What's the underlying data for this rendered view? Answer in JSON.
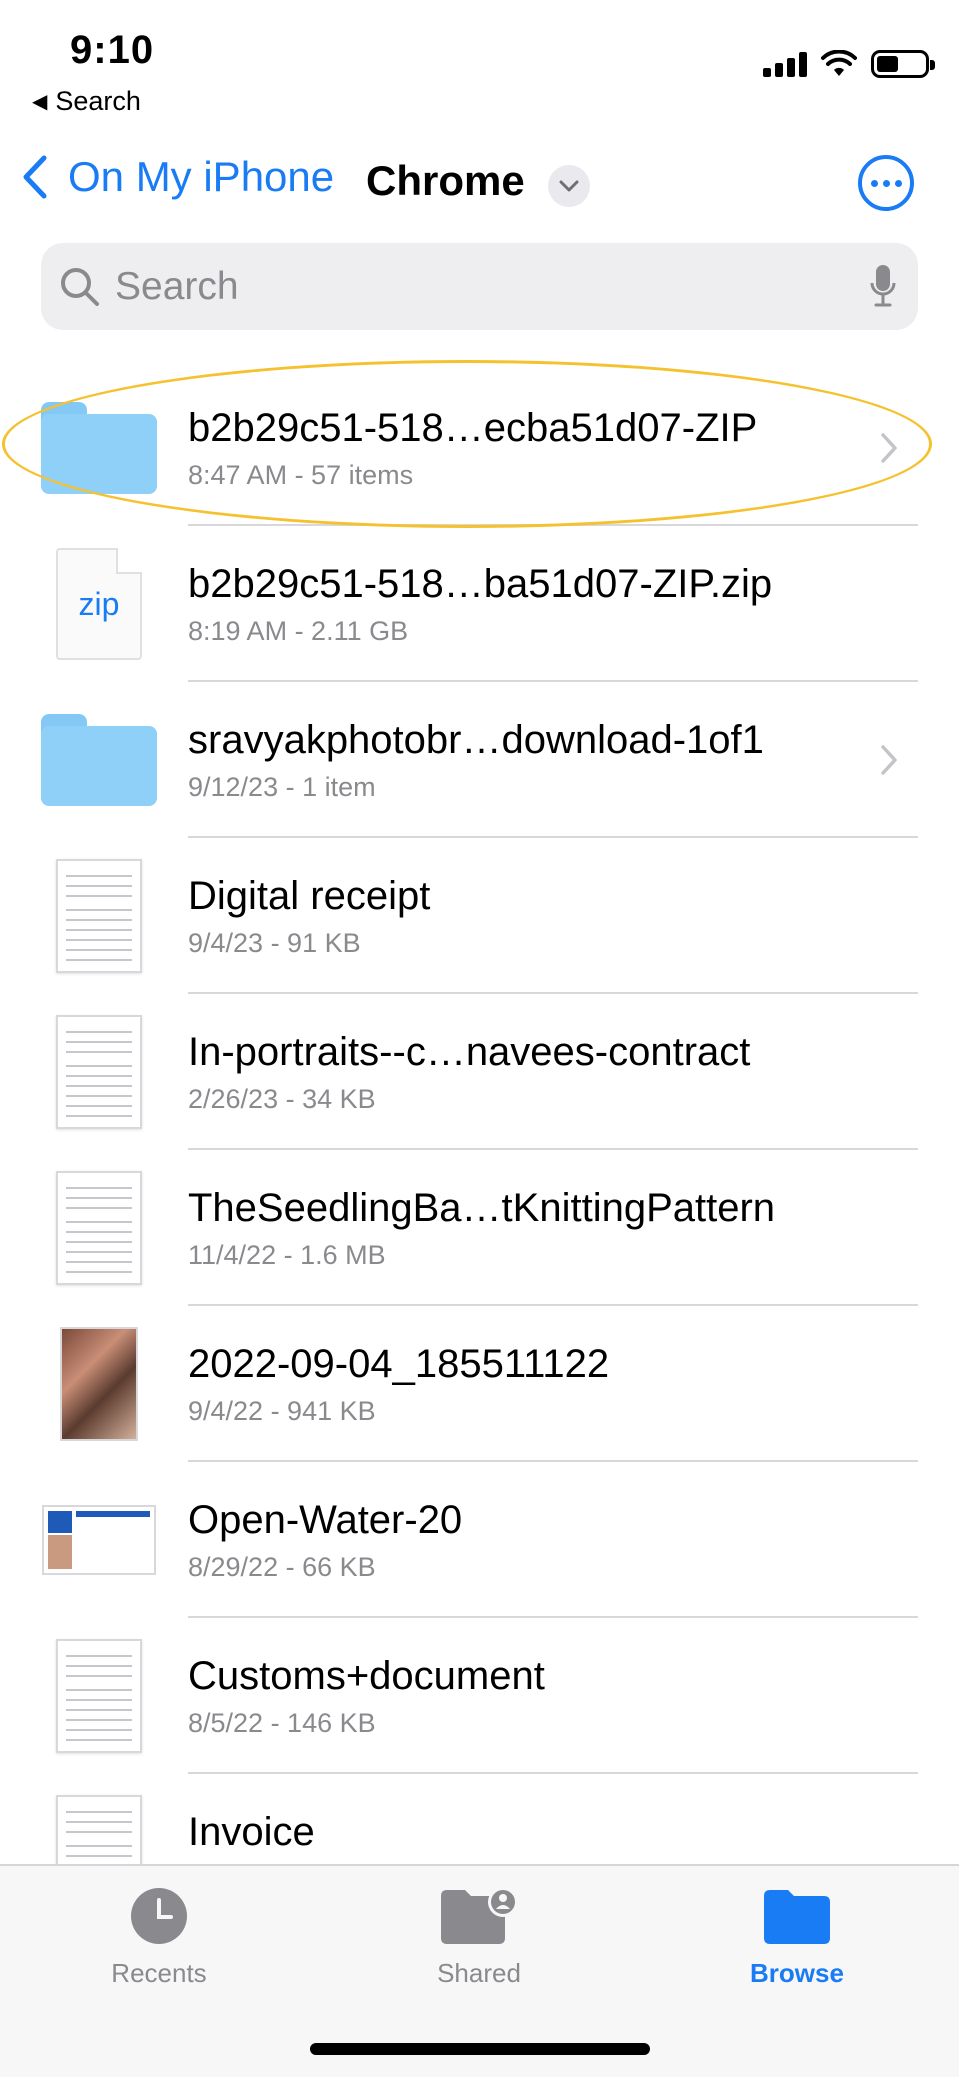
{
  "status": {
    "time": "9:10",
    "back_app": "Search",
    "battery_level": 0.45
  },
  "nav": {
    "back_label": "On My iPhone",
    "title": "Chrome"
  },
  "search": {
    "placeholder": "Search"
  },
  "files": [
    {
      "name": "b2b29c51-518…ecba51d07-ZIP",
      "meta": "8:47 AM - 57 items",
      "kind": "folder",
      "has_chevron": true,
      "highlighted": true
    },
    {
      "name": "b2b29c51-518…ba51d07-ZIP.zip",
      "meta": "8:19 AM - 2.11 GB",
      "kind": "zip",
      "zip_label": "zip",
      "has_chevron": false
    },
    {
      "name": "sravyakphotobr…download-1of1",
      "meta": "9/12/23 - 1 item",
      "kind": "folder",
      "has_chevron": true
    },
    {
      "name": "Digital receipt",
      "meta": "9/4/23 - 91 KB",
      "kind": "document",
      "has_chevron": false
    },
    {
      "name": "In-portraits--c…navees-contract",
      "meta": "2/26/23 - 34 KB",
      "kind": "document",
      "has_chevron": false
    },
    {
      "name": "TheSeedlingBa…tKnittingPattern",
      "meta": "11/4/22 - 1.6 MB",
      "kind": "document",
      "has_chevron": false
    },
    {
      "name": "2022-09-04_185511122",
      "meta": "9/4/22 - 941 KB",
      "kind": "photo",
      "has_chevron": false
    },
    {
      "name": "Open-Water-20",
      "meta": "8/29/22 - 66 KB",
      "kind": "card",
      "has_chevron": false
    },
    {
      "name": "Customs+document",
      "meta": "8/5/22 - 146 KB",
      "kind": "document",
      "has_chevron": false
    },
    {
      "name": "Invoice",
      "meta": "",
      "kind": "document",
      "has_chevron": false
    }
  ],
  "tabbar": {
    "recents": "Recents",
    "shared": "Shared",
    "browse": "Browse",
    "active": "Browse"
  },
  "colors": {
    "accent": "#1a7cf5",
    "folder": "#8fd0f8",
    "highlight": "#f5c12e"
  }
}
